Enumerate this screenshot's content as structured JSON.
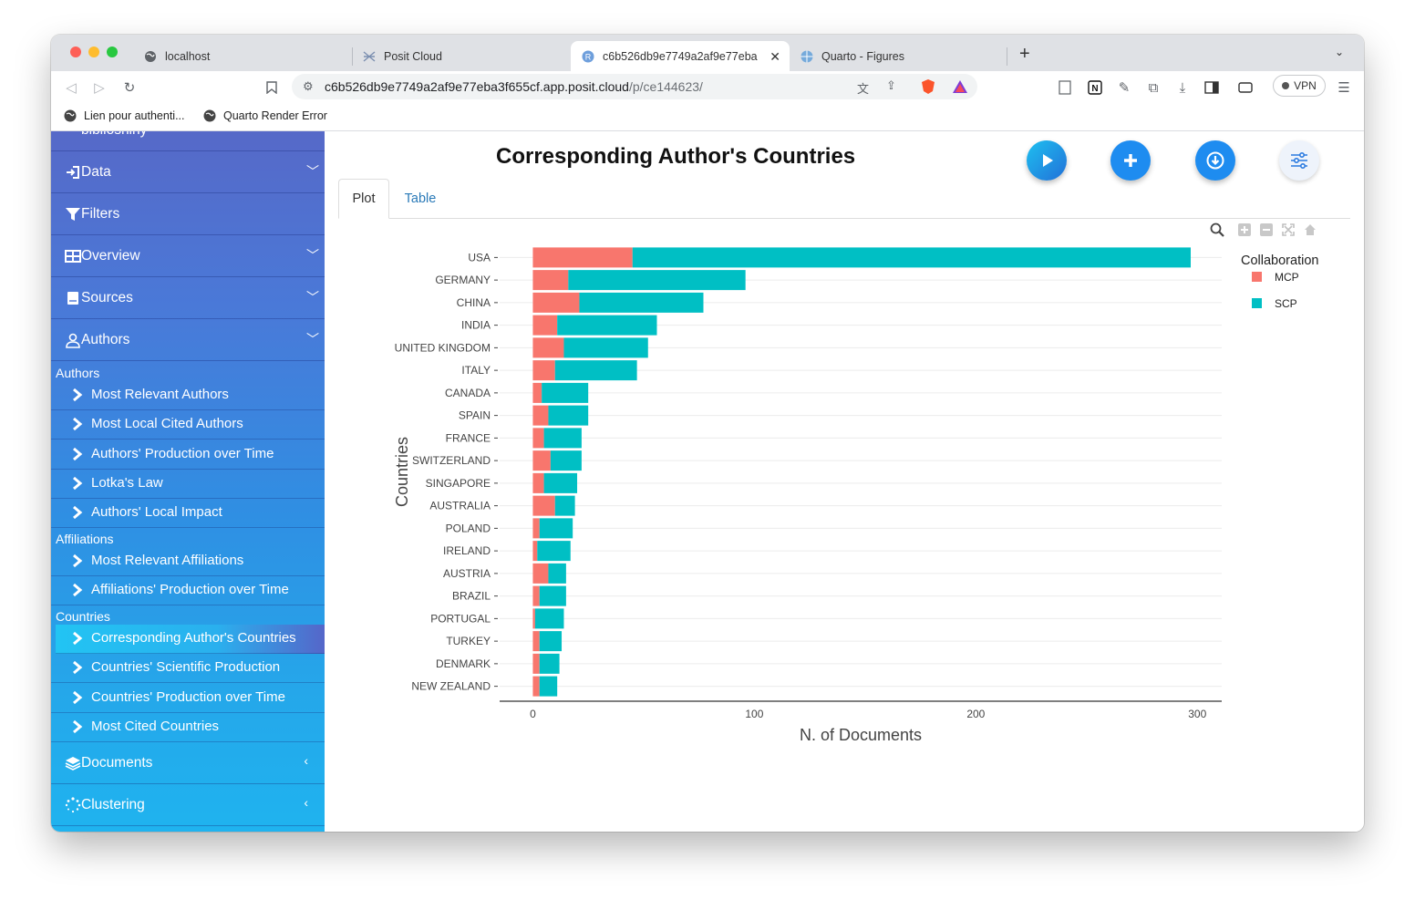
{
  "browser": {
    "tabs": [
      {
        "label": "localhost"
      },
      {
        "label": "Posit Cloud"
      },
      {
        "label": "c6b526db9e7749a2af9e77eba"
      },
      {
        "label": "Quarto - Figures"
      }
    ],
    "url_main": "c6b526db9e7749a2af9e77eba3f655cf.app.posit.cloud",
    "url_path": "/p/ce144623/",
    "vpn_label": "VPN",
    "bookmarks": [
      {
        "label": "Lien pour authenti..."
      },
      {
        "label": "Quarto Render Error"
      }
    ]
  },
  "sidebar": {
    "partial_top": "biblioshiny",
    "menu": [
      {
        "label": "Data",
        "icon": "sign-in-icon"
      },
      {
        "label": "Filters",
        "icon": "filter-icon"
      },
      {
        "label": "Overview",
        "icon": "table-icon"
      },
      {
        "label": "Sources",
        "icon": "book-icon"
      },
      {
        "label": "Authors",
        "icon": "user-icon"
      }
    ],
    "sections": {
      "authors": "Authors",
      "affiliations": "Affiliations",
      "countries": "Countries"
    },
    "authors_items": [
      "Most Relevant Authors",
      "Most Local Cited Authors",
      "Authors' Production over Time",
      "Lotka's Law",
      "Authors' Local Impact"
    ],
    "affiliations_items": [
      "Most Relevant Affiliations",
      "Affiliations' Production over Time"
    ],
    "countries_items": [
      "Corresponding Author's Countries",
      "Countries' Scientific Production",
      "Countries' Production over Time",
      "Most Cited Countries"
    ],
    "bottom_menu": [
      {
        "label": "Documents",
        "icon": "layers-icon"
      },
      {
        "label": "Clustering",
        "icon": "spinner-icon"
      }
    ]
  },
  "main": {
    "title": "Corresponding Author's Countries",
    "tabs": [
      "Plot",
      "Table"
    ],
    "colors": {
      "mcp": "#F8766D",
      "scp": "#00BFC4",
      "button_blue": "#1e90ff"
    }
  },
  "chart_data": {
    "type": "bar",
    "orientation": "horizontal",
    "stacked": true,
    "categories": [
      "USA",
      "GERMANY",
      "CHINA",
      "INDIA",
      "UNITED KINGDOM",
      "ITALY",
      "CANADA",
      "SPAIN",
      "FRANCE",
      "SWITZERLAND",
      "SINGAPORE",
      "AUSTRALIA",
      "POLAND",
      "IRELAND",
      "AUSTRIA",
      "BRAZIL",
      "PORTUGAL",
      "TURKEY",
      "DENMARK",
      "NEW ZEALAND"
    ],
    "series": [
      {
        "name": "MCP",
        "color": "#F8766D",
        "values": [
          45,
          16,
          21,
          11,
          14,
          10,
          4,
          7,
          5,
          8,
          5,
          10,
          3,
          2,
          7,
          3,
          1,
          3,
          3,
          3
        ]
      },
      {
        "name": "SCP",
        "color": "#00BFC4",
        "values": [
          252,
          80,
          56,
          45,
          38,
          37,
          21,
          18,
          17,
          14,
          15,
          9,
          15,
          15,
          8,
          12,
          13,
          10,
          9,
          8
        ]
      }
    ],
    "xlabel": "N. of Documents",
    "ylabel": "Countries",
    "xlim": [
      -15,
      311
    ],
    "xticks": [
      0,
      100,
      200,
      300
    ],
    "legend_title": "Collaboration",
    "legend_position": "right",
    "grid": "horizontal"
  }
}
